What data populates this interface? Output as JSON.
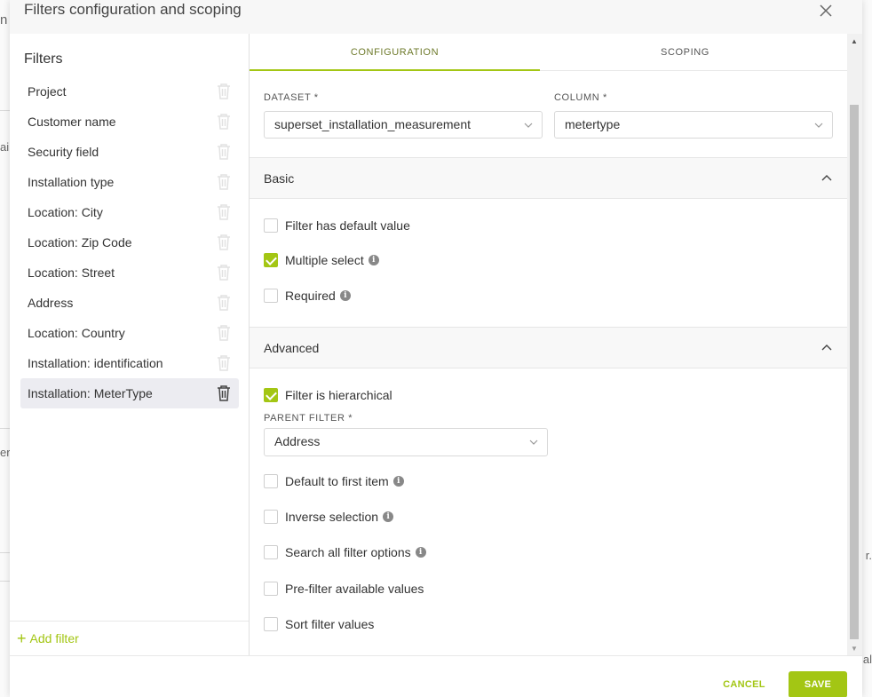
{
  "modal": {
    "title": "Filters configuration and scoping"
  },
  "filters": {
    "heading": "Filters",
    "items": [
      {
        "label": "Project"
      },
      {
        "label": "Customer name"
      },
      {
        "label": "Security field"
      },
      {
        "label": "Installation type"
      },
      {
        "label": "Location: City"
      },
      {
        "label": "Location: Zip Code"
      },
      {
        "label": "Location: Street"
      },
      {
        "label": "Address"
      },
      {
        "label": "Location: Country"
      },
      {
        "label": "Installation: identification"
      },
      {
        "label": "Installation: MeterType"
      }
    ],
    "active_index": 10,
    "add_label": "Add filter"
  },
  "tabs": [
    {
      "label": "CONFIGURATION",
      "active": true
    },
    {
      "label": "SCOPING",
      "active": false
    }
  ],
  "config": {
    "dataset_label": "DATASET",
    "dataset_value": "superset_installation_measurement",
    "column_label": "COLUMN",
    "column_value": "metertype",
    "required_mark": "*"
  },
  "basic": {
    "title": "Basic",
    "options": [
      {
        "label": "Filter has default value",
        "checked": false,
        "info": false
      },
      {
        "label": "Multiple select",
        "checked": true,
        "info": true
      },
      {
        "label": "Required",
        "checked": false,
        "info": true
      }
    ]
  },
  "advanced": {
    "title": "Advanced",
    "hierarchical_label": "Filter is hierarchical",
    "hierarchical_checked": true,
    "parent_filter_label": "PARENT FILTER",
    "parent_filter_value": "Address",
    "options": [
      {
        "label": "Default to first item",
        "checked": false,
        "info": true
      },
      {
        "label": "Inverse selection",
        "checked": false,
        "info": true
      },
      {
        "label": "Search all filter options",
        "checked": false,
        "info": true
      },
      {
        "label": "Pre-filter available values",
        "checked": false,
        "info": false
      },
      {
        "label": "Sort filter values",
        "checked": false,
        "info": false
      }
    ]
  },
  "footer": {
    "cancel_label": "CANCEL",
    "save_label": "SAVE"
  },
  "colors": {
    "accent": "#a3c614",
    "active_item_bg": "#ececf1"
  },
  "icons": {
    "close": "close-icon",
    "trash": "trash-icon",
    "chevron": "chevron-down-icon",
    "caret_up": "chevron-up-icon",
    "info": "info-icon",
    "plus": "plus-icon"
  }
}
